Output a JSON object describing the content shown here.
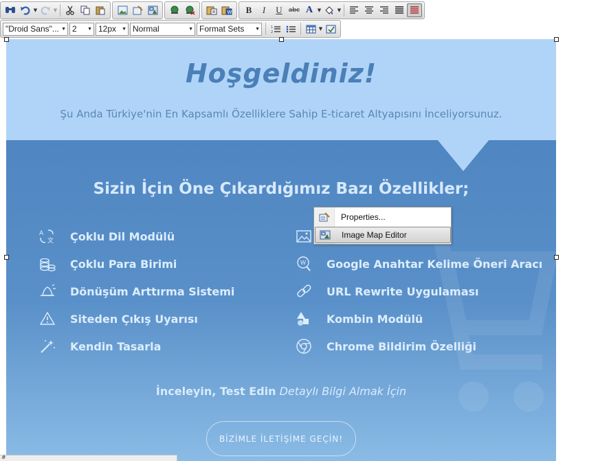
{
  "toolbar": {
    "font_family": "\"Droid Sans\"...",
    "font_size_num": "2",
    "font_size_px": "12px",
    "block_format": "Normal",
    "format_sets": "Format Sets",
    "bold_label": "B",
    "italic_label": "I",
    "underline_label": "U",
    "strike_label": "abc",
    "font_color_label": "A"
  },
  "hero": {
    "title": "Hoşgeldiniz!",
    "subtitle": "Şu Anda Türkiye'nin En Kapsamlı Özelliklere Sahip E-ticaret Altyapısını İnceliyorsunuz."
  },
  "features": {
    "title": "Sizin İçin Öne Çıkardığımız Bazı Özellikler;",
    "left": [
      {
        "label": "Çoklu Dil Modülü",
        "icon": "translate-icon"
      },
      {
        "label": "Çoklu Para Birimi",
        "icon": "coins-icon"
      },
      {
        "label": "Dönüşüm Arttırma Sistemi",
        "icon": "bell-icon"
      },
      {
        "label": "Siteden Çıkış Uyarısı",
        "icon": "warning-icon"
      },
      {
        "label": "Kendin Tasarla",
        "icon": "magic-wand-icon"
      }
    ],
    "right": [
      {
        "label": "",
        "icon": "image-icon"
      },
      {
        "label": "Google Anahtar Kelime Öneri Aracı",
        "icon": "keyword-search-icon"
      },
      {
        "label": "URL Rewrite Uygulaması",
        "icon": "link-icon"
      },
      {
        "label": "Kombin Modülü",
        "icon": "shapes-icon"
      },
      {
        "label": "Chrome Bildirim Özelliği",
        "icon": "chrome-icon"
      }
    ]
  },
  "cta": {
    "bold_text": "İnceleyin, Test Edin",
    "italic_text": "Detaylı Bilgi Almak İçin",
    "button_label": "BİZİMLE İLETİŞİME GEÇİN!"
  },
  "context_menu": {
    "items": [
      {
        "label": "Properties...",
        "icon": "properties-icon"
      },
      {
        "label": "Image Map Editor",
        "icon": "image-map-icon"
      }
    ]
  },
  "status": {
    "path_text": "#"
  }
}
